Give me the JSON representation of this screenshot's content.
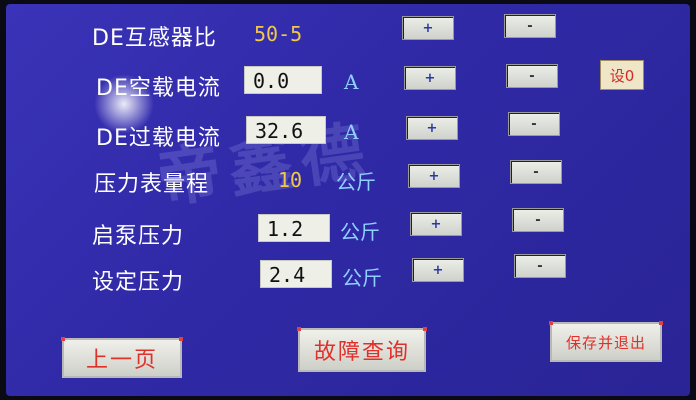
{
  "rows": [
    {
      "label": "DE互感器比",
      "value": "50-5",
      "unit": ""
    },
    {
      "label": "DE空载电流",
      "value": "0.0",
      "unit": "A"
    },
    {
      "label": "DE过载电流",
      "value": "32.6",
      "unit": "A"
    },
    {
      "label": "压力表量程",
      "value": "10",
      "unit": "公斤"
    },
    {
      "label": "启泵压力",
      "value": "1.2",
      "unit": "公斤"
    },
    {
      "label": "设定压力",
      "value": "2.4",
      "unit": "公斤"
    }
  ],
  "buttons": {
    "plus": "+",
    "minus": "-",
    "zero": "设0",
    "prev_page": "上一页",
    "fault_query": "故障查询",
    "save_exit": "保存并退出"
  },
  "watermark": "帝鑫德",
  "colors": {
    "background": "#3a33b8",
    "label": "#ffffff",
    "value": "#f2c84a",
    "unit": "#8fd0ff",
    "button_text": "#e0302a"
  }
}
